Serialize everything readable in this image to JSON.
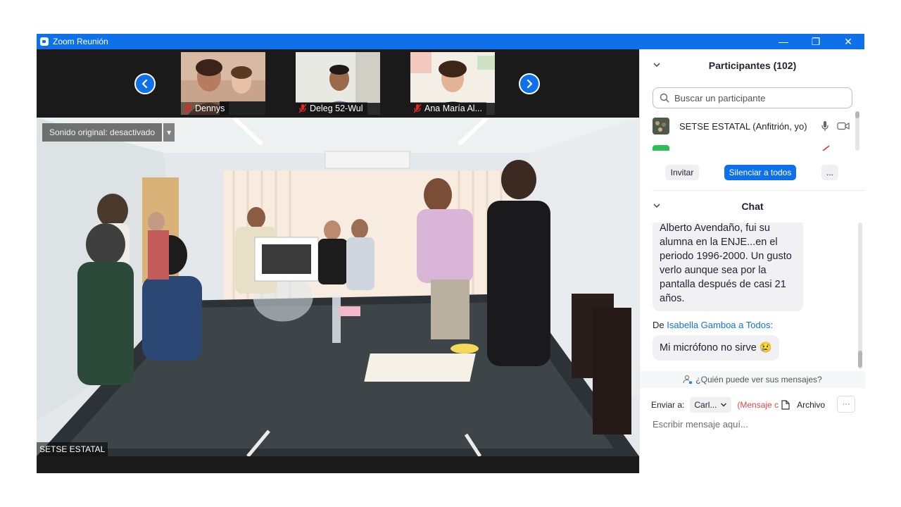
{
  "window": {
    "title": "Zoom Reunión",
    "minimize": "—",
    "restore": "❐",
    "close": "✕"
  },
  "strip": {
    "prev": "‹",
    "next": "›",
    "participants": [
      {
        "name": "Dennys",
        "muted": true
      },
      {
        "name": "Deleg 52-Wul",
        "muted": true
      },
      {
        "name": "Ana María Al...",
        "muted": true
      }
    ]
  },
  "main_video": {
    "sound_label": "Sonido original: desactivado",
    "sound_dropdown": "▾",
    "speaker": "SETSE ESTATAL"
  },
  "participants_panel": {
    "title": "Participantes (102)",
    "search_placeholder": "Buscar un participante",
    "list": [
      {
        "name": "SETSE ESTATAL (Anfitrión, yo)"
      }
    ],
    "invite": "Invitar",
    "mute_all": "Silenciar a todos",
    "more": "..."
  },
  "chat_panel": {
    "title": "Chat",
    "messages": [
      {
        "text_lines": [
          "Alberto Avendaño, fui su",
          "alumna en la ENJE...en el",
          "periodo 1996-2000. Un gusto",
          "verlo aunque sea por la",
          "pantalla después de casi 21",
          "años."
        ]
      },
      {
        "from_prefix": "De",
        "from": "Isabella Gamboa",
        "to_prefix": "a",
        "to": "Todos:",
        "text": "Mi micrófono no sirve 😢"
      }
    ],
    "who_can_see": "¿Quién puede ver sus mensajes?",
    "send_to_label": "Enviar a:",
    "send_to_value": "Carl...",
    "private_tag": "(Mensaje c",
    "file_label": "Archivo",
    "more": "···",
    "input_placeholder": "Escribir mensaje aquí..."
  },
  "colors": {
    "accent": "#0e71eb",
    "mute_red": "#e02828",
    "video_bg": "#1a1a1a"
  }
}
